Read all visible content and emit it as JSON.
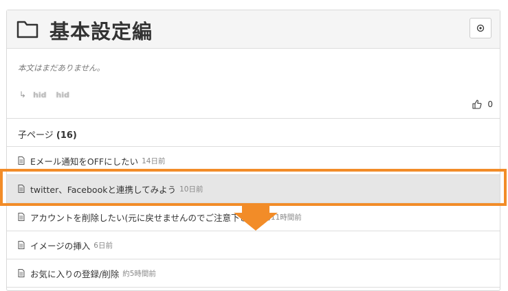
{
  "page": {
    "title": "基本設定編",
    "body_text": "本文はまだありません。",
    "tags": [
      "hid",
      "hid"
    ],
    "likes": "0"
  },
  "subpages": {
    "heading": "子ページ",
    "count": "(16)",
    "items": [
      {
        "title": "Eメール通知をOFFにしたい",
        "time": "14日前"
      },
      {
        "title": "twitter、Facebookと連携してみよう",
        "time": "10日前"
      },
      {
        "title": "アカウントを削除したい(元に戻せませんのでご注意下さい)",
        "time": "約11時間前"
      },
      {
        "title": "イメージの挿入",
        "time": "6日前"
      },
      {
        "title": "お気に入りの登録/削除",
        "time": "約5時間前"
      }
    ]
  },
  "icons": {
    "folder": "folder-icon",
    "watch": "watch-icon",
    "tag_arrow": "tag-arrow-icon",
    "like": "thumbs-up-icon",
    "document": "document-icon"
  },
  "colors": {
    "highlight_border": "#f28c28",
    "highlight_row": "#e6e6e6",
    "header_bg": "#f5f5f5"
  }
}
